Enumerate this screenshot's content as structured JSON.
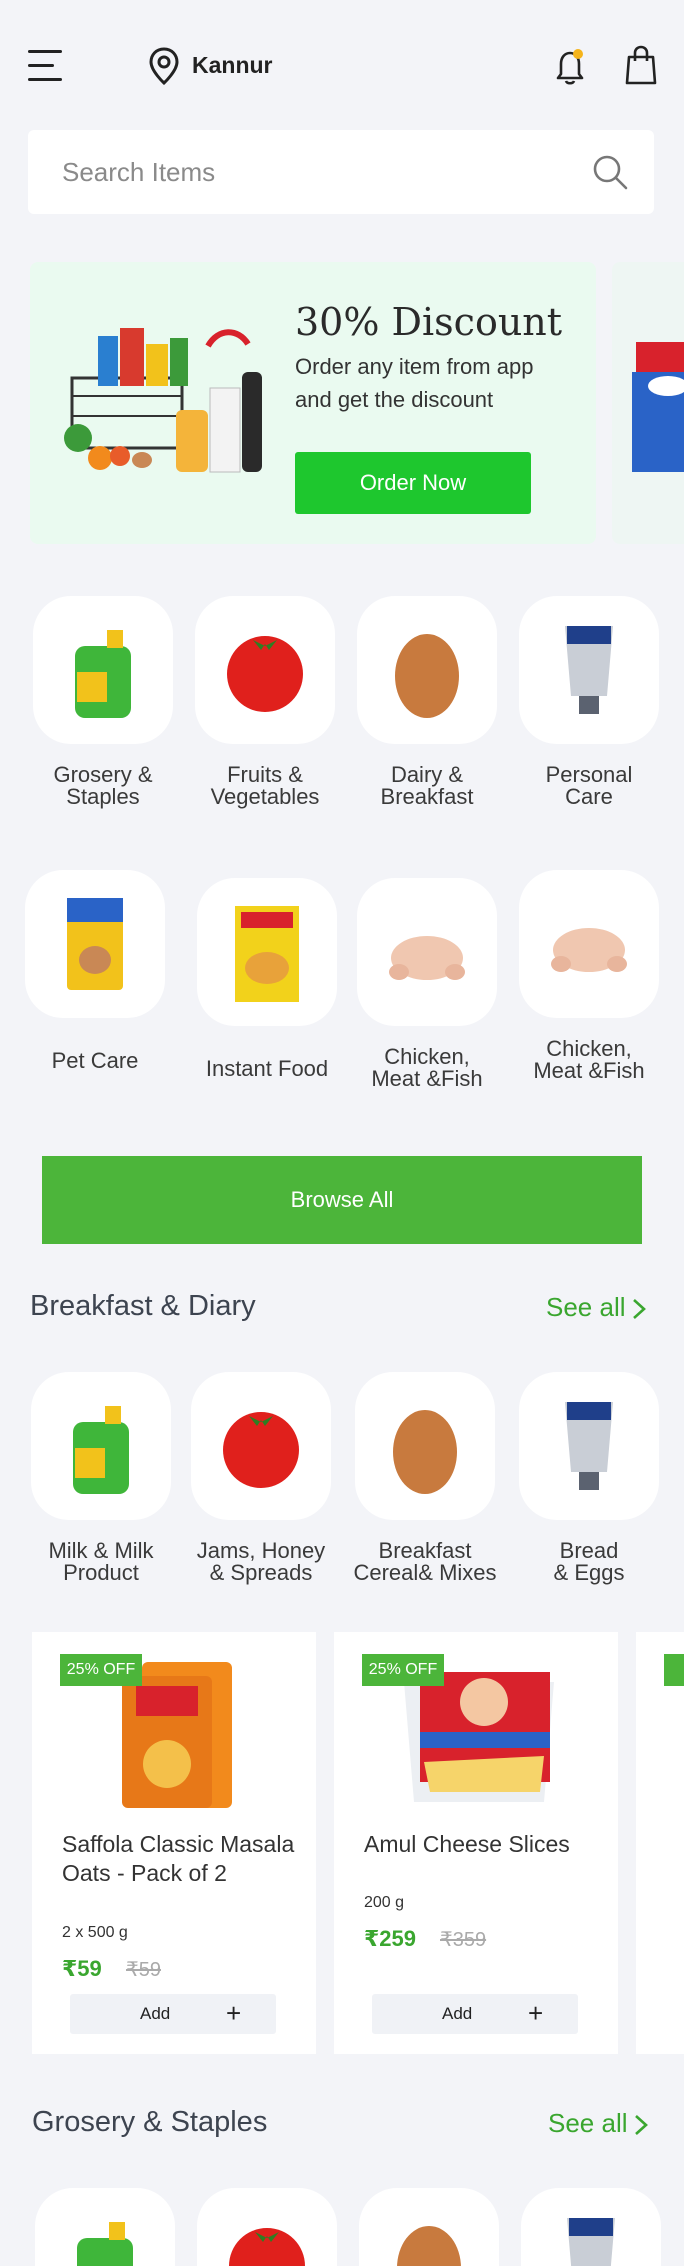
{
  "header": {
    "location": "Kannur"
  },
  "search": {
    "placeholder": "Search Items"
  },
  "banner": {
    "title": "30% Discount",
    "description": "Order any item from app and get the discount",
    "button": "Order Now"
  },
  "categories": [
    {
      "label": "Grosery &\nStaples",
      "icon": "oil-can"
    },
    {
      "label": "Fruits &\nVegetables",
      "icon": "tomato"
    },
    {
      "label": "Dairy &\nBreakfast",
      "icon": "egg"
    },
    {
      "label": "Personal\nCare",
      "icon": "cream-tube"
    },
    {
      "label": "Pet Care",
      "icon": "pet-food"
    },
    {
      "label": "Instant Food",
      "icon": "noodles-pack"
    },
    {
      "label": "Chicken,\nMeat &Fish",
      "icon": "chicken"
    },
    {
      "label": "Chicken,\nMeat &Fish",
      "icon": "chicken"
    }
  ],
  "browse": {
    "label": "Browse All"
  },
  "breakfast": {
    "title": "Breakfast & Diary",
    "see_all": "See all",
    "subcategories": [
      {
        "label": "Milk & Milk\nProduct"
      },
      {
        "label": "Jams, Honey\n& Spreads"
      },
      {
        "label": "Breakfast\nCereal& Mixes"
      },
      {
        "label": "Bread\n& Eggs"
      }
    ],
    "products": [
      {
        "badge": "25% OFF",
        "name": "Saffola Classic Masala Oats - Pack of 2",
        "weight": "2 x 500 g",
        "price": "₹59",
        "mrp": "₹59",
        "add": "Add"
      },
      {
        "badge": "25% OFF",
        "name": "Amul Cheese Slices",
        "weight": "200 g",
        "price": "₹259",
        "mrp": "₹359",
        "add": "Add"
      }
    ]
  },
  "grosery": {
    "title": "Grosery & Staples",
    "see_all": "See all"
  },
  "colors": {
    "accent": "#4cb53a",
    "cta": "#1ec72e",
    "background": "#f3f4f8"
  }
}
